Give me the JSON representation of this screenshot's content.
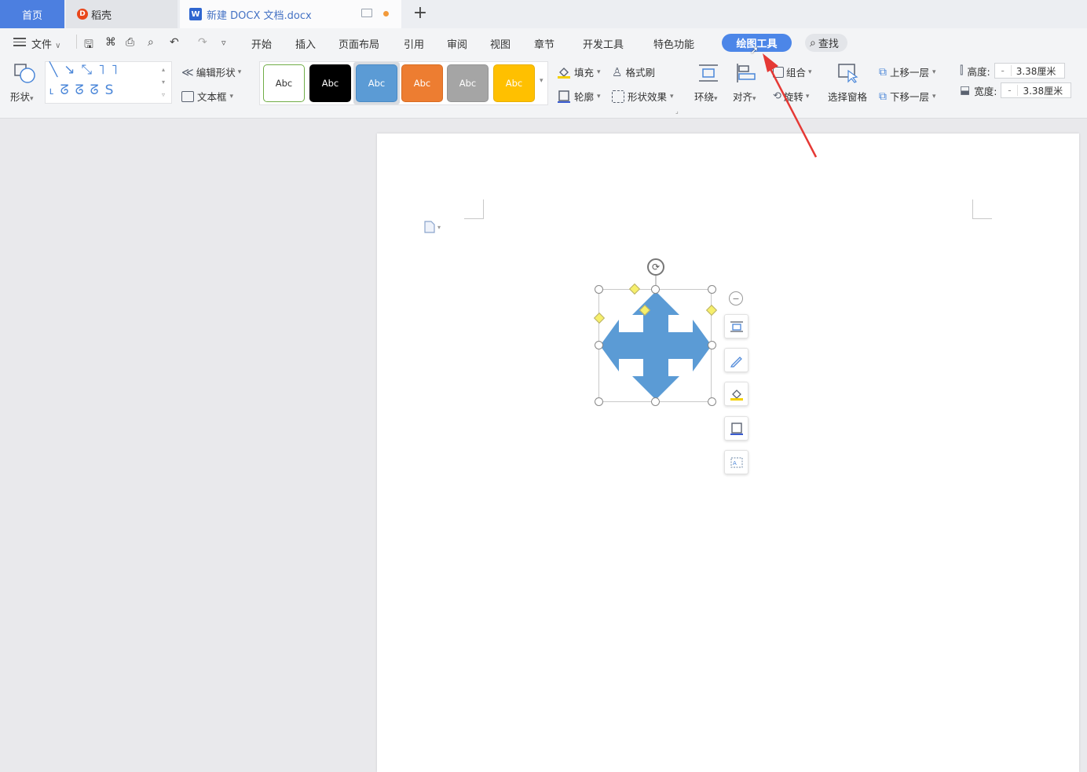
{
  "tabs": {
    "home": "首页",
    "daoke": "稻壳",
    "document": "新建 DOCX 文档.docx",
    "new_tab": "+"
  },
  "menu": {
    "file": "文件",
    "items": [
      "开始",
      "插入",
      "页面布局",
      "引用",
      "审阅",
      "视图",
      "章节",
      "开发工具",
      "特色功能"
    ],
    "active_tab": "绘图工具",
    "search": "查找"
  },
  "ribbon": {
    "shapes": "形状",
    "edit_shape": "编辑形状",
    "text_box": "文本框",
    "style_swatches": [
      {
        "label": "Abc",
        "bg": "#ffffff",
        "fg": "#333333",
        "border": "#70ad47"
      },
      {
        "label": "Abc",
        "bg": "#000000",
        "fg": "#ffffff",
        "border": "#000000"
      },
      {
        "label": "Abc",
        "bg": "#5b9bd5",
        "fg": "#ffffff",
        "border": "#4a8ac4"
      },
      {
        "label": "Abc",
        "bg": "#ed7d31",
        "fg": "#ffffff",
        "border": "#d86c22"
      },
      {
        "label": "Abc",
        "bg": "#a5a5a5",
        "fg": "#ffffff",
        "border": "#949494"
      },
      {
        "label": "Abc",
        "bg": "#ffc000",
        "fg": "#ffffff",
        "border": "#e8af00"
      }
    ],
    "fill": "填充",
    "format_painter": "格式刷",
    "outline": "轮廓",
    "shape_effects": "形状效果",
    "wrap": "环绕",
    "align": "对齐",
    "group": "组合",
    "rotate": "旋转",
    "selection_pane": "选择窗格",
    "bring_forward": "上移一层",
    "send_backward": "下移一层",
    "height_label": "高度:",
    "height_value": "3.38厘米",
    "width_label": "宽度:",
    "width_value": "3.38厘米",
    "spin_minus": "-"
  },
  "colors": {
    "accent": "#4c86e8",
    "shape_fill": "#5b9bd5",
    "annotation_arrow": "#e53935"
  },
  "floating_toolbar": [
    "collapse-icon",
    "layout-options-icon",
    "pen-icon",
    "fill-icon",
    "outline-icon",
    "text-wrap-icon"
  ]
}
